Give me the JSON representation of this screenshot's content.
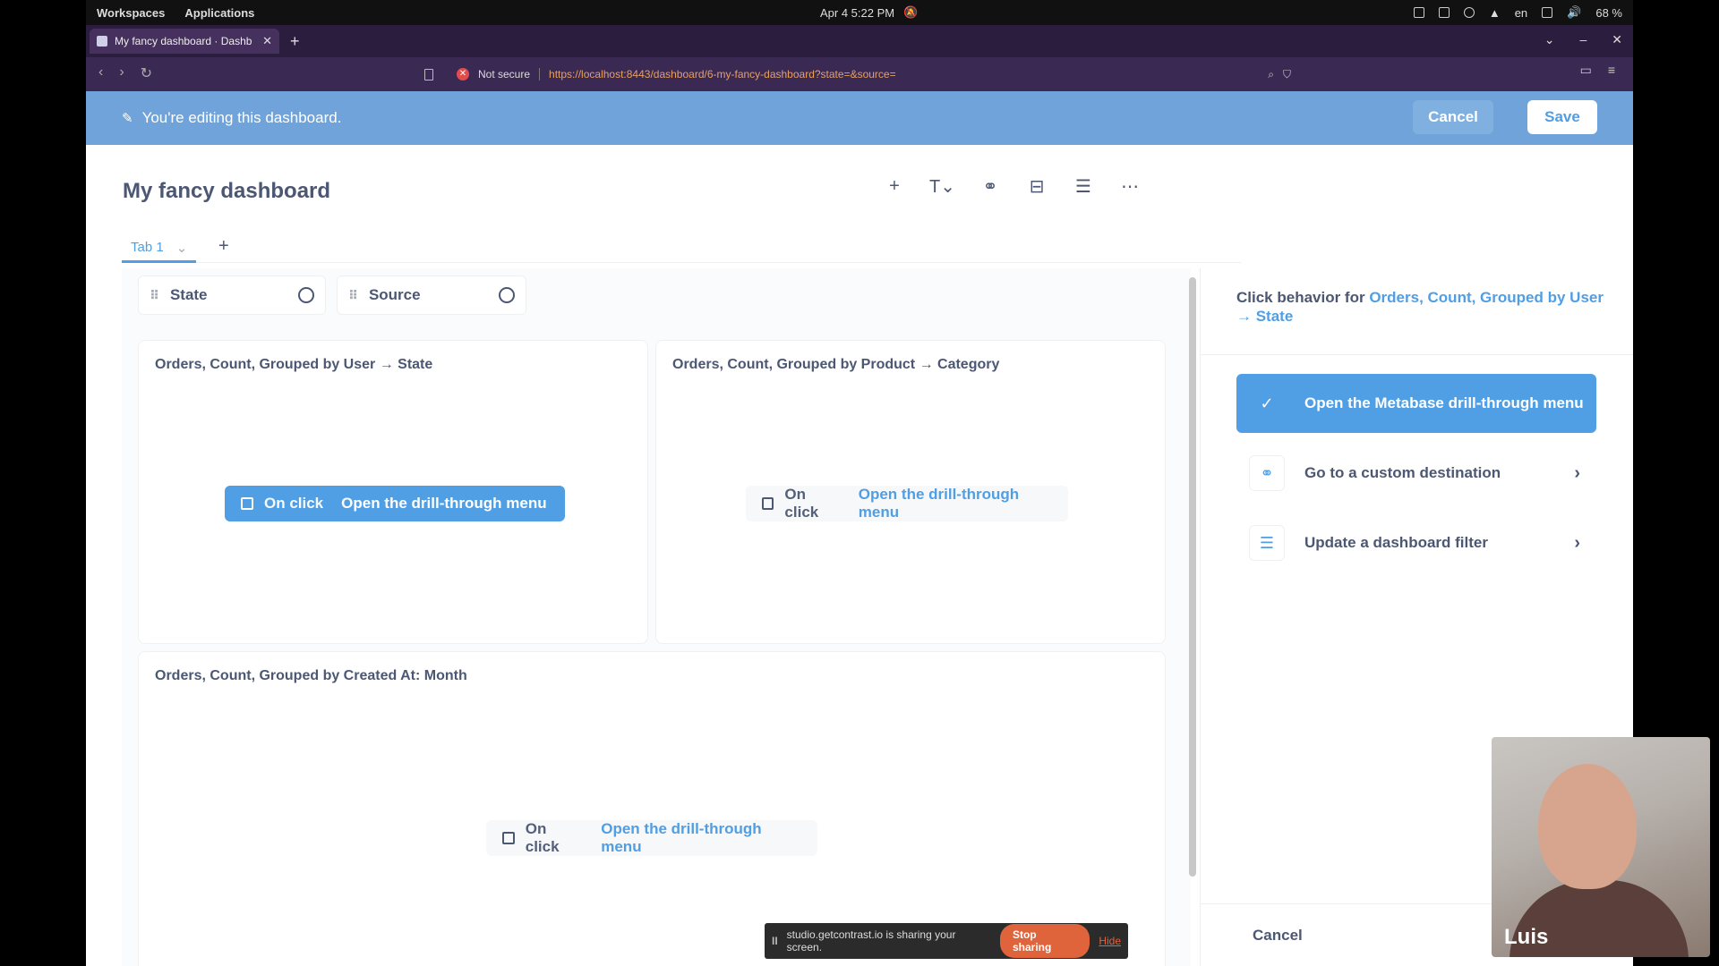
{
  "os": {
    "workspaces": "Workspaces",
    "applications": "Applications",
    "datetime": "Apr 4  5:22 PM",
    "lang": "en",
    "battery": "68 %"
  },
  "browser": {
    "tab_title": "My fancy dashboard · Dashb",
    "not_secure": "Not secure",
    "url": "https://localhost:8443/dashboard/6-my-fancy-dashboard?state=&source="
  },
  "banner": {
    "message": "You're editing this dashboard.",
    "cancel": "Cancel",
    "save": "Save"
  },
  "dashboard": {
    "title": "My fancy dashboard",
    "tab": "Tab 1",
    "filters": [
      "State",
      "Source"
    ],
    "cards": [
      {
        "title": "Orders, Count, Grouped by User → State",
        "on_click": "On click",
        "action": "Open the drill-through menu"
      },
      {
        "title": "Orders, Count, Grouped by Product → Category",
        "on_click": "On click",
        "action": "Open the drill-through menu"
      },
      {
        "title": "Orders, Count, Grouped by Created At: Month",
        "on_click": "On click",
        "action": "Open the drill-through menu"
      }
    ]
  },
  "sidebar": {
    "heading_prefix": "Click behavior for ",
    "heading_link": "Orders, Count, Grouped by User → State",
    "options": [
      {
        "label": "Open the Metabase drill-through menu",
        "icon": "check-icon"
      },
      {
        "label": "Go to a custom destination",
        "icon": "link-icon"
      },
      {
        "label": "Update a dashboard filter",
        "icon": "filter-icon"
      }
    ],
    "cancel": "Cancel"
  },
  "share_notice": {
    "text": "studio.getcontrast.io is sharing your screen.",
    "stop": "Stop sharing",
    "hide": "Hide"
  },
  "webcam": {
    "name": "Luis"
  }
}
